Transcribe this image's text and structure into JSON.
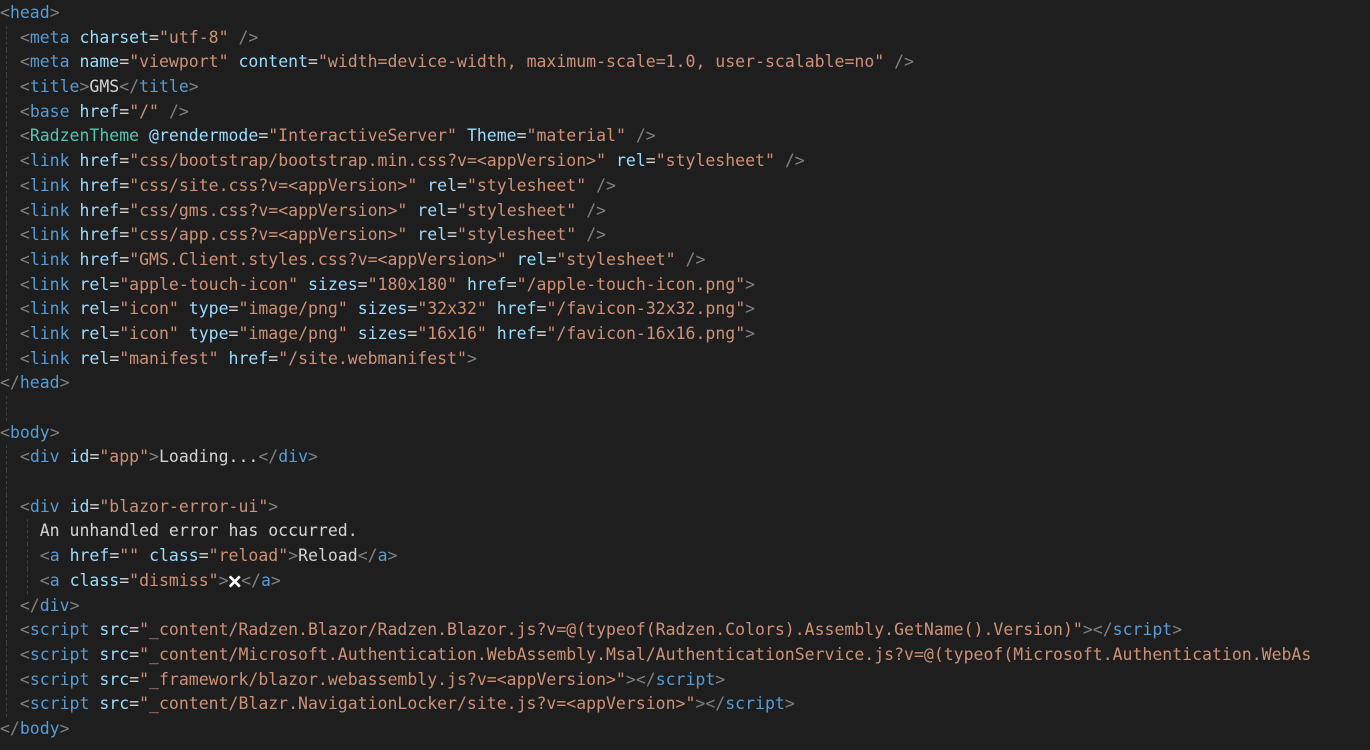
{
  "theme": {
    "background": "#1e1e1e",
    "tag": "#569cd6",
    "bracket": "#808080",
    "attribute": "#9cdcfe",
    "string": "#ce9178",
    "text": "#d4d4d4",
    "component": "#4ec9b0"
  },
  "lines": [
    {
      "indent": "",
      "guides": 0,
      "tokens": [
        [
          "b",
          "<"
        ],
        [
          "g",
          "head"
        ],
        [
          "b",
          ">"
        ]
      ]
    },
    {
      "indent": "  ",
      "guides": 1,
      "tokens": [
        [
          "b",
          "<"
        ],
        [
          "g",
          "meta"
        ],
        [
          "t",
          " "
        ],
        [
          "a",
          "charset"
        ],
        [
          "t",
          "="
        ],
        [
          "s",
          "\"utf-8\""
        ],
        [
          "t",
          " "
        ],
        [
          "b",
          "/>"
        ]
      ]
    },
    {
      "indent": "  ",
      "guides": 1,
      "tokens": [
        [
          "b",
          "<"
        ],
        [
          "g",
          "meta"
        ],
        [
          "t",
          " "
        ],
        [
          "a",
          "name"
        ],
        [
          "t",
          "="
        ],
        [
          "s",
          "\"viewport\""
        ],
        [
          "t",
          " "
        ],
        [
          "a",
          "content"
        ],
        [
          "t",
          "="
        ],
        [
          "s",
          "\"width=device-width, maximum-scale=1.0, user-scalable=no\""
        ],
        [
          "t",
          " "
        ],
        [
          "b",
          "/>"
        ]
      ]
    },
    {
      "indent": "  ",
      "guides": 1,
      "tokens": [
        [
          "b",
          "<"
        ],
        [
          "g",
          "title"
        ],
        [
          "b",
          ">"
        ],
        [
          "t",
          "GMS"
        ],
        [
          "b",
          "</"
        ],
        [
          "g",
          "title"
        ],
        [
          "b",
          ">"
        ]
      ]
    },
    {
      "indent": "  ",
      "guides": 1,
      "tokens": [
        [
          "b",
          "<"
        ],
        [
          "g",
          "base"
        ],
        [
          "t",
          " "
        ],
        [
          "a",
          "href"
        ],
        [
          "t",
          "="
        ],
        [
          "s",
          "\"/\""
        ],
        [
          "t",
          " "
        ],
        [
          "b",
          "/>"
        ]
      ]
    },
    {
      "indent": "  ",
      "guides": 1,
      "tokens": [
        [
          "b",
          "<"
        ],
        [
          "c",
          "RadzenTheme"
        ],
        [
          "t",
          " "
        ],
        [
          "a",
          "@rendermode"
        ],
        [
          "t",
          "="
        ],
        [
          "s",
          "\"InteractiveServer\""
        ],
        [
          "t",
          " "
        ],
        [
          "a",
          "Theme"
        ],
        [
          "t",
          "="
        ],
        [
          "s",
          "\"material\""
        ],
        [
          "t",
          " "
        ],
        [
          "b",
          "/>"
        ]
      ]
    },
    {
      "indent": "  ",
      "guides": 1,
      "tokens": [
        [
          "b",
          "<"
        ],
        [
          "g",
          "link"
        ],
        [
          "t",
          " "
        ],
        [
          "a",
          "href"
        ],
        [
          "t",
          "="
        ],
        [
          "s",
          "\"css/bootstrap/bootstrap.min.css?v=<appVersion>\""
        ],
        [
          "t",
          " "
        ],
        [
          "a",
          "rel"
        ],
        [
          "t",
          "="
        ],
        [
          "s",
          "\"stylesheet\""
        ],
        [
          "t",
          " "
        ],
        [
          "b",
          "/>"
        ]
      ]
    },
    {
      "indent": "  ",
      "guides": 1,
      "tokens": [
        [
          "b",
          "<"
        ],
        [
          "g",
          "link"
        ],
        [
          "t",
          " "
        ],
        [
          "a",
          "href"
        ],
        [
          "t",
          "="
        ],
        [
          "s",
          "\"css/site.css?v=<appVersion>\""
        ],
        [
          "t",
          " "
        ],
        [
          "a",
          "rel"
        ],
        [
          "t",
          "="
        ],
        [
          "s",
          "\"stylesheet\""
        ],
        [
          "t",
          " "
        ],
        [
          "b",
          "/>"
        ]
      ]
    },
    {
      "indent": "  ",
      "guides": 1,
      "tokens": [
        [
          "b",
          "<"
        ],
        [
          "g",
          "link"
        ],
        [
          "t",
          " "
        ],
        [
          "a",
          "href"
        ],
        [
          "t",
          "="
        ],
        [
          "s",
          "\"css/gms.css?v=<appVersion>\""
        ],
        [
          "t",
          " "
        ],
        [
          "a",
          "rel"
        ],
        [
          "t",
          "="
        ],
        [
          "s",
          "\"stylesheet\""
        ],
        [
          "t",
          " "
        ],
        [
          "b",
          "/>"
        ]
      ]
    },
    {
      "indent": "  ",
      "guides": 1,
      "tokens": [
        [
          "b",
          "<"
        ],
        [
          "g",
          "link"
        ],
        [
          "t",
          " "
        ],
        [
          "a",
          "href"
        ],
        [
          "t",
          "="
        ],
        [
          "s",
          "\"css/app.css?v=<appVersion>\""
        ],
        [
          "t",
          " "
        ],
        [
          "a",
          "rel"
        ],
        [
          "t",
          "="
        ],
        [
          "s",
          "\"stylesheet\""
        ],
        [
          "t",
          " "
        ],
        [
          "b",
          "/>"
        ]
      ]
    },
    {
      "indent": "  ",
      "guides": 1,
      "tokens": [
        [
          "b",
          "<"
        ],
        [
          "g",
          "link"
        ],
        [
          "t",
          " "
        ],
        [
          "a",
          "href"
        ],
        [
          "t",
          "="
        ],
        [
          "s",
          "\"GMS.Client.styles.css?v=<appVersion>\""
        ],
        [
          "t",
          " "
        ],
        [
          "a",
          "rel"
        ],
        [
          "t",
          "="
        ],
        [
          "s",
          "\"stylesheet\""
        ],
        [
          "t",
          " "
        ],
        [
          "b",
          "/>"
        ]
      ]
    },
    {
      "indent": "  ",
      "guides": 1,
      "tokens": [
        [
          "b",
          "<"
        ],
        [
          "g",
          "link"
        ],
        [
          "t",
          " "
        ],
        [
          "a",
          "rel"
        ],
        [
          "t",
          "="
        ],
        [
          "s",
          "\"apple-touch-icon\""
        ],
        [
          "t",
          " "
        ],
        [
          "a",
          "sizes"
        ],
        [
          "t",
          "="
        ],
        [
          "s",
          "\"180x180\""
        ],
        [
          "t",
          " "
        ],
        [
          "a",
          "href"
        ],
        [
          "t",
          "="
        ],
        [
          "s",
          "\"/apple-touch-icon.png\""
        ],
        [
          "b",
          ">"
        ]
      ]
    },
    {
      "indent": "  ",
      "guides": 1,
      "tokens": [
        [
          "b",
          "<"
        ],
        [
          "g",
          "link"
        ],
        [
          "t",
          " "
        ],
        [
          "a",
          "rel"
        ],
        [
          "t",
          "="
        ],
        [
          "s",
          "\"icon\""
        ],
        [
          "t",
          " "
        ],
        [
          "a",
          "type"
        ],
        [
          "t",
          "="
        ],
        [
          "s",
          "\"image/png\""
        ],
        [
          "t",
          " "
        ],
        [
          "a",
          "sizes"
        ],
        [
          "t",
          "="
        ],
        [
          "s",
          "\"32x32\""
        ],
        [
          "t",
          " "
        ],
        [
          "a",
          "href"
        ],
        [
          "t",
          "="
        ],
        [
          "s",
          "\"/favicon-32x32.png\""
        ],
        [
          "b",
          ">"
        ]
      ]
    },
    {
      "indent": "  ",
      "guides": 1,
      "tokens": [
        [
          "b",
          "<"
        ],
        [
          "g",
          "link"
        ],
        [
          "t",
          " "
        ],
        [
          "a",
          "rel"
        ],
        [
          "t",
          "="
        ],
        [
          "s",
          "\"icon\""
        ],
        [
          "t",
          " "
        ],
        [
          "a",
          "type"
        ],
        [
          "t",
          "="
        ],
        [
          "s",
          "\"image/png\""
        ],
        [
          "t",
          " "
        ],
        [
          "a",
          "sizes"
        ],
        [
          "t",
          "="
        ],
        [
          "s",
          "\"16x16\""
        ],
        [
          "t",
          " "
        ],
        [
          "a",
          "href"
        ],
        [
          "t",
          "="
        ],
        [
          "s",
          "\"/favicon-16x16.png\""
        ],
        [
          "b",
          ">"
        ]
      ]
    },
    {
      "indent": "  ",
      "guides": 1,
      "tokens": [
        [
          "b",
          "<"
        ],
        [
          "g",
          "link"
        ],
        [
          "t",
          " "
        ],
        [
          "a",
          "rel"
        ],
        [
          "t",
          "="
        ],
        [
          "s",
          "\"manifest\""
        ],
        [
          "t",
          " "
        ],
        [
          "a",
          "href"
        ],
        [
          "t",
          "="
        ],
        [
          "s",
          "\"/site.webmanifest\""
        ],
        [
          "b",
          ">"
        ]
      ]
    },
    {
      "indent": "",
      "guides": 0,
      "tokens": [
        [
          "b",
          "</"
        ],
        [
          "g",
          "head"
        ],
        [
          "b",
          ">"
        ]
      ]
    },
    {
      "indent": "",
      "guides": 1,
      "tokens": []
    },
    {
      "indent": "",
      "guides": 0,
      "tokens": [
        [
          "b",
          "<"
        ],
        [
          "g",
          "body"
        ],
        [
          "b",
          ">"
        ]
      ]
    },
    {
      "indent": "  ",
      "guides": 1,
      "tokens": [
        [
          "b",
          "<"
        ],
        [
          "g",
          "div"
        ],
        [
          "t",
          " "
        ],
        [
          "a",
          "id"
        ],
        [
          "t",
          "="
        ],
        [
          "s",
          "\"app\""
        ],
        [
          "b",
          ">"
        ],
        [
          "t",
          "Loading..."
        ],
        [
          "b",
          "</"
        ],
        [
          "g",
          "div"
        ],
        [
          "b",
          ">"
        ]
      ]
    },
    {
      "indent": "",
      "guides": 1,
      "tokens": []
    },
    {
      "indent": "  ",
      "guides": 1,
      "tokens": [
        [
          "b",
          "<"
        ],
        [
          "g",
          "div"
        ],
        [
          "t",
          " "
        ],
        [
          "a",
          "id"
        ],
        [
          "t",
          "="
        ],
        [
          "s",
          "\"blazor-error-ui\""
        ],
        [
          "b",
          ">"
        ]
      ]
    },
    {
      "indent": "    ",
      "guides": 2,
      "tokens": [
        [
          "t",
          "An unhandled error has occurred."
        ]
      ]
    },
    {
      "indent": "    ",
      "guides": 2,
      "tokens": [
        [
          "b",
          "<"
        ],
        [
          "g",
          "a"
        ],
        [
          "t",
          " "
        ],
        [
          "a",
          "href"
        ],
        [
          "t",
          "="
        ],
        [
          "s",
          "\"\""
        ],
        [
          "t",
          " "
        ],
        [
          "a",
          "class"
        ],
        [
          "t",
          "="
        ],
        [
          "s",
          "\"reload\""
        ],
        [
          "b",
          ">"
        ],
        [
          "t",
          "Reload"
        ],
        [
          "b",
          "</"
        ],
        [
          "g",
          "a"
        ],
        [
          "b",
          ">"
        ]
      ]
    },
    {
      "indent": "    ",
      "guides": 2,
      "tokens": [
        [
          "b",
          "<"
        ],
        [
          "g",
          "a"
        ],
        [
          "t",
          " "
        ],
        [
          "a",
          "class"
        ],
        [
          "t",
          "="
        ],
        [
          "s",
          "\"dismiss\""
        ],
        [
          "b",
          ">"
        ],
        [
          "x",
          "🗙"
        ],
        [
          "b",
          "</"
        ],
        [
          "g",
          "a"
        ],
        [
          "b",
          ">"
        ]
      ]
    },
    {
      "indent": "  ",
      "guides": 1,
      "tokens": [
        [
          "b",
          "</"
        ],
        [
          "g",
          "div"
        ],
        [
          "b",
          ">"
        ]
      ]
    },
    {
      "indent": "  ",
      "guides": 1,
      "tokens": [
        [
          "b",
          "<"
        ],
        [
          "g",
          "script"
        ],
        [
          "t",
          " "
        ],
        [
          "a",
          "src"
        ],
        [
          "t",
          "="
        ],
        [
          "s",
          "\"_content/Radzen.Blazor/Radzen.Blazor.js?v=@(typeof(Radzen.Colors).Assembly.GetName().Version)\""
        ],
        [
          "b",
          ">"
        ],
        [
          "b",
          "</"
        ],
        [
          "g",
          "script"
        ],
        [
          "b",
          ">"
        ]
      ]
    },
    {
      "indent": "  ",
      "guides": 1,
      "tokens": [
        [
          "b",
          "<"
        ],
        [
          "g",
          "script"
        ],
        [
          "t",
          " "
        ],
        [
          "a",
          "src"
        ],
        [
          "t",
          "="
        ],
        [
          "s",
          "\"_content/Microsoft.Authentication.WebAssembly.Msal/AuthenticationService.js?v=@(typeof(Microsoft.Authentication.WebAs"
        ]
      ]
    },
    {
      "indent": "  ",
      "guides": 1,
      "tokens": [
        [
          "b",
          "<"
        ],
        [
          "g",
          "script"
        ],
        [
          "t",
          " "
        ],
        [
          "a",
          "src"
        ],
        [
          "t",
          "="
        ],
        [
          "s",
          "\"_framework/blazor.webassembly.js?v=<appVersion>\""
        ],
        [
          "b",
          ">"
        ],
        [
          "b",
          "</"
        ],
        [
          "g",
          "script"
        ],
        [
          "b",
          ">"
        ]
      ]
    },
    {
      "indent": "  ",
      "guides": 1,
      "tokens": [
        [
          "b",
          "<"
        ],
        [
          "g",
          "script"
        ],
        [
          "t",
          " "
        ],
        [
          "a",
          "src"
        ],
        [
          "t",
          "="
        ],
        [
          "s",
          "\"_content/Blazr.NavigationLocker/site.js?v=<appVersion>\""
        ],
        [
          "b",
          ">"
        ],
        [
          "b",
          "</"
        ],
        [
          "g",
          "script"
        ],
        [
          "b",
          ">"
        ]
      ]
    },
    {
      "indent": "",
      "guides": 0,
      "tokens": [
        [
          "b",
          "</"
        ],
        [
          "g",
          "body"
        ],
        [
          "b",
          ">"
        ]
      ]
    }
  ]
}
